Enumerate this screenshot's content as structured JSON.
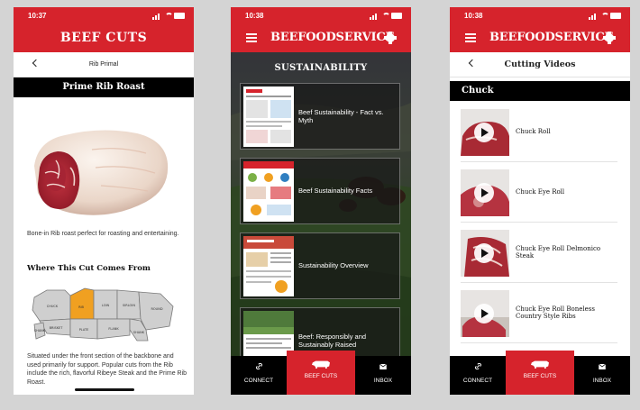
{
  "colors": {
    "brand_red": "#d6232c",
    "black": "#000000"
  },
  "phone1": {
    "status_time": "10:37",
    "header_title": "BEEF CUTS",
    "nav_title": "Rib Primal",
    "cut_title": "Prime Rib Roast",
    "description": "Bone-in Rib roast perfect for roasting and entertaining.",
    "where_heading": "Where This Cut Comes From",
    "map_labels": {
      "chuck": "CHUCK",
      "rib": "RIB",
      "loin": "LOIN",
      "sirloin": "SIRLOIN",
      "round": "ROUND",
      "brisket": "BRISKET",
      "plate": "PLATE",
      "flank": "FLANK",
      "shank": "SHANK"
    },
    "situated_text": "Situated under the front section of the backbone and used primarily for support. Popular cuts from the Rib include the rich, flavorful Ribeye Steak and the Prime Rib Roast."
  },
  "phone2": {
    "status_time": "10:38",
    "brand": "BEEFOODSERVICE",
    "section_title": "SUSTAINABILITY",
    "cards": [
      {
        "title": "Beef Sustainability - Fact vs. Myth"
      },
      {
        "title": "Beef Sustainability Facts"
      },
      {
        "title": "Sustainability Overview"
      },
      {
        "title": "Beef: Responsibly and Sustainably Raised"
      }
    ]
  },
  "phone3": {
    "status_time": "10:38",
    "brand": "BEEFOODSERVICE",
    "nav_title": "Cutting Videos",
    "section": "Chuck",
    "videos": [
      {
        "title": "Chuck Roll"
      },
      {
        "title": "Chuck Eye Roll"
      },
      {
        "title": "Chuck Eye Roll Delmonico Steak"
      },
      {
        "title": "Chuck Eye Roll Boneless Country Style Ribs"
      }
    ]
  },
  "tabbar": {
    "connect": "CONNECT",
    "beef_cuts": "BEEF CUTS",
    "inbox": "INBOX"
  }
}
